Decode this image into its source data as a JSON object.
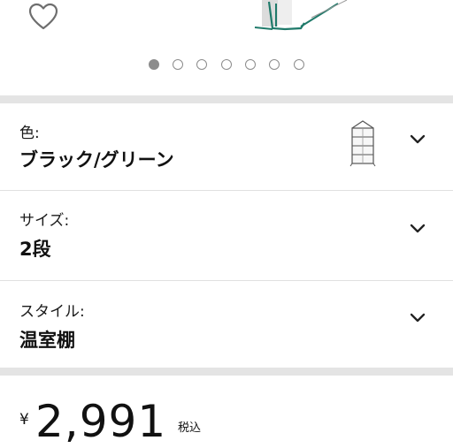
{
  "carousel": {
    "slide_count": 7,
    "active_index": 0
  },
  "options": {
    "color": {
      "label": "色:",
      "value": "ブラック/グリーン"
    },
    "size": {
      "label": "サイズ:",
      "value": "2段"
    },
    "style": {
      "label": "スタイル:",
      "value": "温室棚"
    }
  },
  "price": {
    "currency": "¥",
    "amount": "2,991",
    "tax_note": "税込"
  },
  "icons": {
    "wishlist": "heart-icon",
    "dropdown": "chevron-down-icon",
    "product_thumbnail": "greenhouse-shelf-icon"
  },
  "colors": {
    "separator": "#e4e4e4",
    "dot": "#8c8c8c",
    "product_frame": "#1f7a6a"
  }
}
